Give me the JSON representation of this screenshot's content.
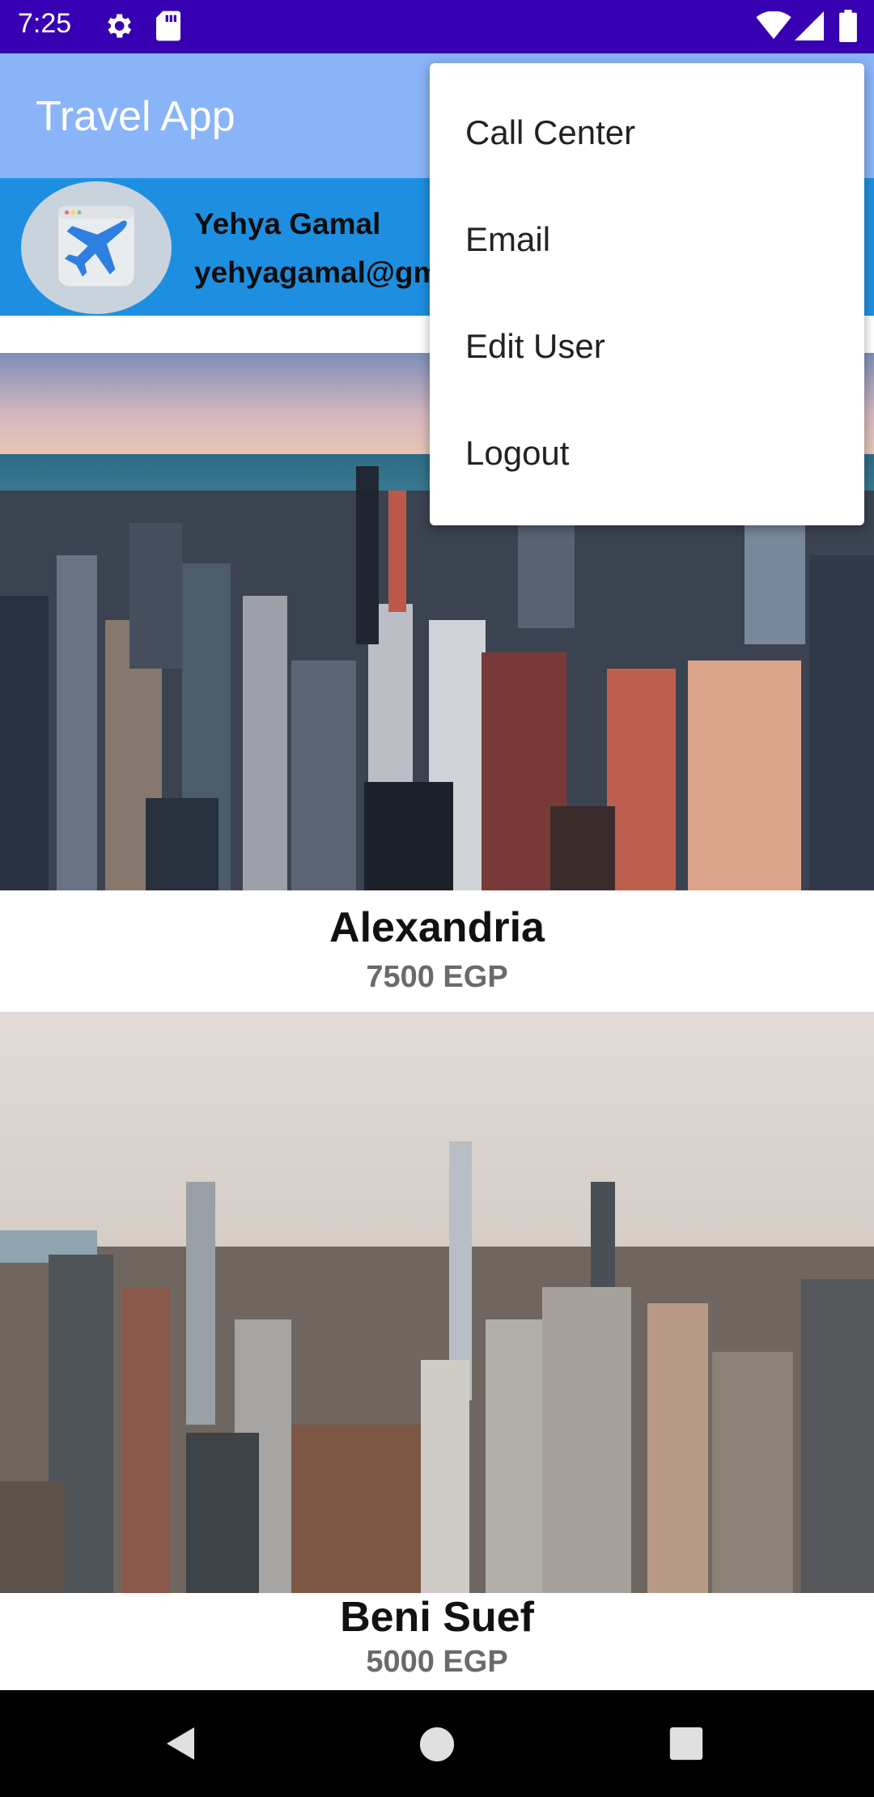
{
  "status_bar": {
    "time": "7:25",
    "icons": [
      "gear-icon",
      "sd-card-icon",
      "wifi-icon",
      "cell-signal-icon",
      "battery-icon"
    ],
    "background": "#3700b3"
  },
  "app_bar": {
    "title": "Travel App",
    "background": "#8ab4f8"
  },
  "user_header": {
    "name": "Yehya Gamal",
    "email": "yehyagamal@gm",
    "avatar_icon": "airplane-icon",
    "background": "#1e8fe0"
  },
  "destinations": [
    {
      "name": "Alexandria",
      "price": "7500 EGP"
    },
    {
      "name": "Beni Suef",
      "price": "5000 EGP"
    }
  ],
  "overflow_menu": {
    "items": [
      {
        "label": "Call Center"
      },
      {
        "label": "Email"
      },
      {
        "label": "Edit User"
      },
      {
        "label": "Logout"
      }
    ]
  },
  "nav_bar": {
    "icons": [
      "back-icon",
      "home-icon",
      "recents-icon"
    ]
  }
}
